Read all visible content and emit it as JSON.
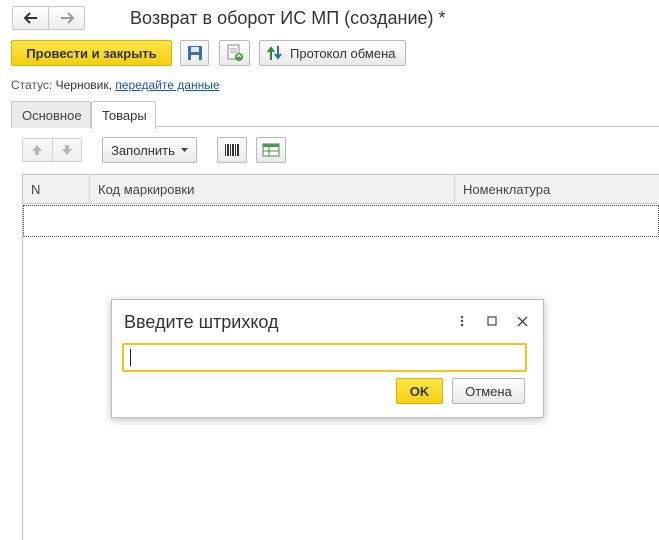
{
  "form": {
    "title": "Возврат в оборот ИС МП (создание) *"
  },
  "command_bar": {
    "post_and_close": "Провести и закрыть",
    "exchange_protocol": "Протокол обмена"
  },
  "status": {
    "label": "Статус:",
    "value": "Черновик,",
    "link": "передайте данные"
  },
  "tabs": [
    {
      "label": "Основное",
      "active": false
    },
    {
      "label": "Товары",
      "active": true
    }
  ],
  "table_toolbar": {
    "fill_label": "Заполнить"
  },
  "grid": {
    "columns": [
      "N",
      "Код маркировки",
      "Номенклатура"
    ],
    "rows": []
  },
  "dialog": {
    "title": "Введите штрихкод",
    "input_value": "",
    "ok_label": "OK",
    "cancel_label": "Отмена"
  },
  "icons": {
    "back": "arrow-left-icon",
    "forward": "arrow-right-icon",
    "save": "floppy-disk-icon",
    "document": "document-refresh-icon",
    "protocol": "exchange-arrows-icon",
    "move_up": "arrow-up-icon",
    "move_down": "arrow-down-icon",
    "dropdown": "triangle-down-icon",
    "barcode": "barcode-icon",
    "table": "table-icon",
    "dialog_menu": "vertical-dots-icon",
    "dialog_maximize": "maximize-icon",
    "dialog_close": "close-icon"
  },
  "colors": {
    "accent_yellow": "#f5cf10",
    "link_blue": "#1a55a6",
    "input_focus": "#f0c419"
  }
}
